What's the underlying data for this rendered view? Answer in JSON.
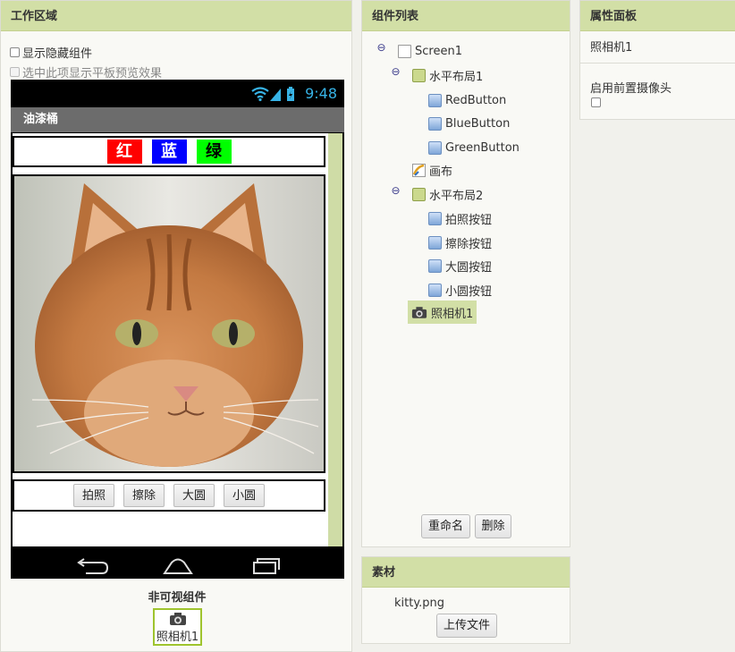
{
  "work": {
    "header": "工作区域",
    "show_hidden": "显示隐藏组件",
    "tablet_preview": "选中此项显示平板预览效果",
    "status_time": "9:48",
    "app_title": "油漆桶",
    "color_buttons": [
      {
        "label": "红",
        "color": "#ff0000"
      },
      {
        "label": "蓝",
        "color": "#0000ff"
      },
      {
        "label": "绿",
        "color": "#00ff00"
      }
    ],
    "action_buttons": [
      "拍照",
      "擦除",
      "大圆",
      "小圆"
    ],
    "nonvisible_title": "非可视组件",
    "nonvisible_item": "照相机1"
  },
  "components": {
    "header": "组件列表",
    "tree": {
      "screen": "Screen1",
      "layout1": "水平布局1",
      "red": "RedButton",
      "blue": "BlueButton",
      "green": "GreenButton",
      "canvas": "画布",
      "layout2": "水平布局2",
      "photo": "拍照按钮",
      "erase": "擦除按钮",
      "big": "大圆按钮",
      "small": "小圆按钮",
      "camera": "照相机1"
    },
    "rename": "重命名",
    "delete": "删除"
  },
  "assets": {
    "header": "素材",
    "file": "kitty.png",
    "upload": "上传文件"
  },
  "props": {
    "header": "属性面板",
    "component": "照相机1",
    "front_camera_label": "启用前置摄像头"
  }
}
